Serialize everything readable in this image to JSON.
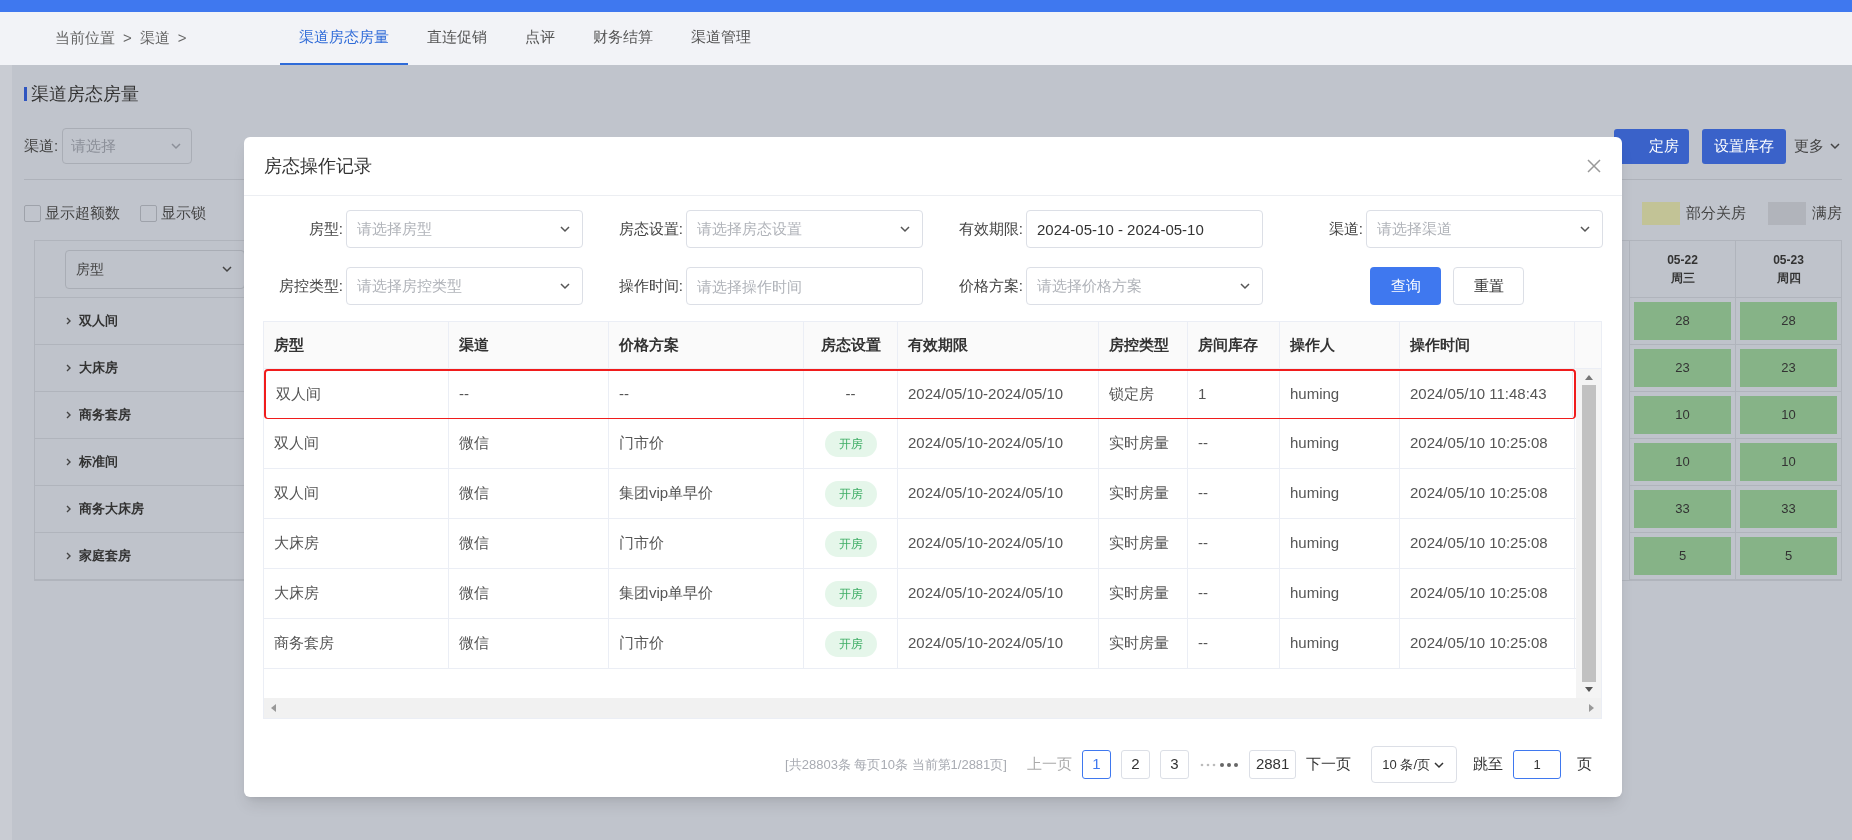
{
  "breadcrumb": [
    "当前位置",
    ">",
    "渠道",
    ">"
  ],
  "nav_tabs": [
    {
      "label": "渠道房态房量",
      "selected": true
    },
    {
      "label": "直连促销",
      "selected": false
    },
    {
      "label": "点评",
      "selected": false
    },
    {
      "label": "财务结算",
      "selected": false
    },
    {
      "label": "渠道管理",
      "selected": false
    }
  ],
  "page_title": "渠道房态房量",
  "filter": {
    "channel_label": "渠道:",
    "channel_placeholder": "请选择"
  },
  "toolbar": {
    "partial_button": "定房",
    "button": "设置库存",
    "more": "更多"
  },
  "checkboxes": [
    {
      "label": "显示超额数",
      "checked": false
    },
    {
      "label": "显示锁",
      "checked": false
    }
  ],
  "legend": [
    {
      "label": "部分关房",
      "color": "#c2c396"
    },
    {
      "label": "满房",
      "color": "#b1b4bb"
    }
  ],
  "grid": {
    "column_selector": "房型",
    "rows": [
      "双人间",
      "大床房",
      "商务套房",
      "标准间",
      "商务大床房",
      "家庭套房"
    ],
    "dates": [
      {
        "date": "05-22",
        "weekday": "周三",
        "values": [
          "28",
          "23",
          "10",
          "10",
          "33",
          "5"
        ]
      },
      {
        "date": "05-23",
        "weekday": "周四",
        "values": [
          "28",
          "23",
          "10",
          "10",
          "33",
          "5"
        ]
      }
    ]
  },
  "dialog": {
    "title": "房态操作记录",
    "filters": [
      {
        "label": "房型:",
        "kind": "select",
        "placeholder": "请选择房型"
      },
      {
        "label": "房态设置:",
        "kind": "select",
        "placeholder": "请选择房态设置"
      },
      {
        "label": "有效期限:",
        "kind": "input",
        "value": "2024-05-10 - 2024-05-10"
      },
      {
        "label": "渠道:",
        "kind": "select",
        "placeholder": "请选择渠道"
      },
      {
        "label": "房控类型:",
        "kind": "select",
        "placeholder": "请选择房控类型"
      },
      {
        "label": "操作时间:",
        "kind": "input",
        "placeholder": "请选择操作时间"
      },
      {
        "label": "价格方案:",
        "kind": "select",
        "placeholder": "请选择价格方案"
      }
    ],
    "search_button": "查询",
    "reset_button": "重置",
    "columns": [
      "房型",
      "渠道",
      "价格方案",
      "房态设置",
      "有效期限",
      "房控类型",
      "房间库存",
      "操作人",
      "操作时间"
    ],
    "rows": [
      {
        "highlighted": true,
        "room": "双人间",
        "channel": "--",
        "plan": "--",
        "status": {
          "kind": "text",
          "text": "--"
        },
        "validity": "2024/05/10-2024/05/10",
        "control": "锁定房",
        "stock": "1",
        "operator": "huming",
        "time": "2024/05/10 11:48:43"
      },
      {
        "highlighted": false,
        "room": "双人间",
        "channel": "微信",
        "plan": "门市价",
        "status": {
          "kind": "tag",
          "text": "开房"
        },
        "validity": "2024/05/10-2024/05/10",
        "control": "实时房量",
        "stock": "--",
        "operator": "huming",
        "time": "2024/05/10 10:25:08"
      },
      {
        "highlighted": false,
        "room": "双人间",
        "channel": "微信",
        "plan": "集团vip单早价",
        "status": {
          "kind": "tag",
          "text": "开房"
        },
        "validity": "2024/05/10-2024/05/10",
        "control": "实时房量",
        "stock": "--",
        "operator": "huming",
        "time": "2024/05/10 10:25:08"
      },
      {
        "highlighted": false,
        "room": "大床房",
        "channel": "微信",
        "plan": "门市价",
        "status": {
          "kind": "tag",
          "text": "开房"
        },
        "validity": "2024/05/10-2024/05/10",
        "control": "实时房量",
        "stock": "--",
        "operator": "huming",
        "time": "2024/05/10 10:25:08"
      },
      {
        "highlighted": false,
        "room": "大床房",
        "channel": "微信",
        "plan": "集团vip单早价",
        "status": {
          "kind": "tag",
          "text": "开房"
        },
        "validity": "2024/05/10-2024/05/10",
        "control": "实时房量",
        "stock": "--",
        "operator": "huming",
        "time": "2024/05/10 10:25:08"
      },
      {
        "highlighted": false,
        "room": "商务套房",
        "channel": "微信",
        "plan": "门市价",
        "status": {
          "kind": "tag",
          "text": "开房"
        },
        "validity": "2024/05/10-2024/05/10",
        "control": "实时房量",
        "stock": "--",
        "operator": "huming",
        "time": "2024/05/10 10:25:08"
      }
    ],
    "pagination": {
      "summary": "[共28803条 每页10条 当前第1/2881页]",
      "prev": "上一页",
      "pages": [
        {
          "label": "1",
          "selected": true
        },
        {
          "label": "2",
          "selected": false
        },
        {
          "label": "3",
          "selected": false
        }
      ],
      "last_page": "2881",
      "next": "下一页",
      "page_size": "10 条/页",
      "jump_label": "跳至",
      "jump_value": "1",
      "page_unit": "页"
    }
  }
}
